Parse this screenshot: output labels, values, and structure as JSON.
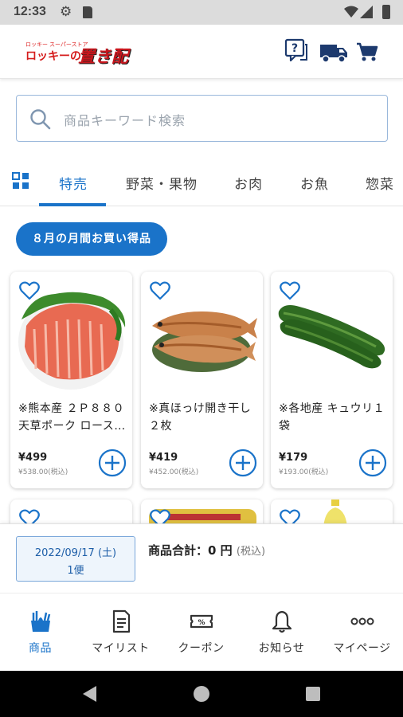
{
  "status_bar": {
    "time": "12:33",
    "icons": [
      "gear-icon",
      "sd-card-icon",
      "wifi-icon",
      "signal-icon",
      "battery-icon"
    ]
  },
  "header": {
    "logo_sub": "ロッキー スーパーストア",
    "logo_main": "ロッキーの",
    "logo_brand": "置き配",
    "icons": [
      "help-icon",
      "delivery-truck-icon",
      "cart-icon"
    ]
  },
  "search": {
    "placeholder": "商品キーワード検索"
  },
  "tabs": {
    "items": [
      "特売",
      "野菜・果物",
      "お肉",
      "お魚",
      "惣菜"
    ],
    "active": "特売"
  },
  "promo_chip": "８月の月間お買い得品",
  "products": [
    {
      "name": "※熊本産 ２Ｐ８８０ 天草ポーク ロース…",
      "price": "¥499",
      "tax_price": "¥538.00(税込)",
      "image": "pork-loin-icon"
    },
    {
      "name": "※真ほっけ開き干し ２枚",
      "price": "¥419",
      "tax_price": "¥452.00(税込)",
      "image": "dried-fish-icon"
    },
    {
      "name": "※各地産 キュウリ１袋",
      "price": "¥179",
      "tax_price": "¥193.00(税込)",
      "image": "cucumber-icon"
    }
  ],
  "cart_summary": {
    "date": "2022/09/17 (土)",
    "slot": "1便",
    "total_label": "商品合計：0 円",
    "tax_note": "(税込)"
  },
  "bottom_nav": [
    {
      "label": "商品",
      "icon": "products-icon",
      "active": true
    },
    {
      "label": "マイリスト",
      "icon": "mylist-icon",
      "active": false
    },
    {
      "label": "クーポン",
      "icon": "coupon-icon",
      "active": false
    },
    {
      "label": "お知らせ",
      "icon": "bell-icon",
      "active": false
    },
    {
      "label": "マイページ",
      "icon": "more-icon",
      "active": false
    }
  ],
  "colors": {
    "accent": "#1a73c9",
    "brand_red": "#d51c1c",
    "status_bar": "#dcdcdc"
  }
}
